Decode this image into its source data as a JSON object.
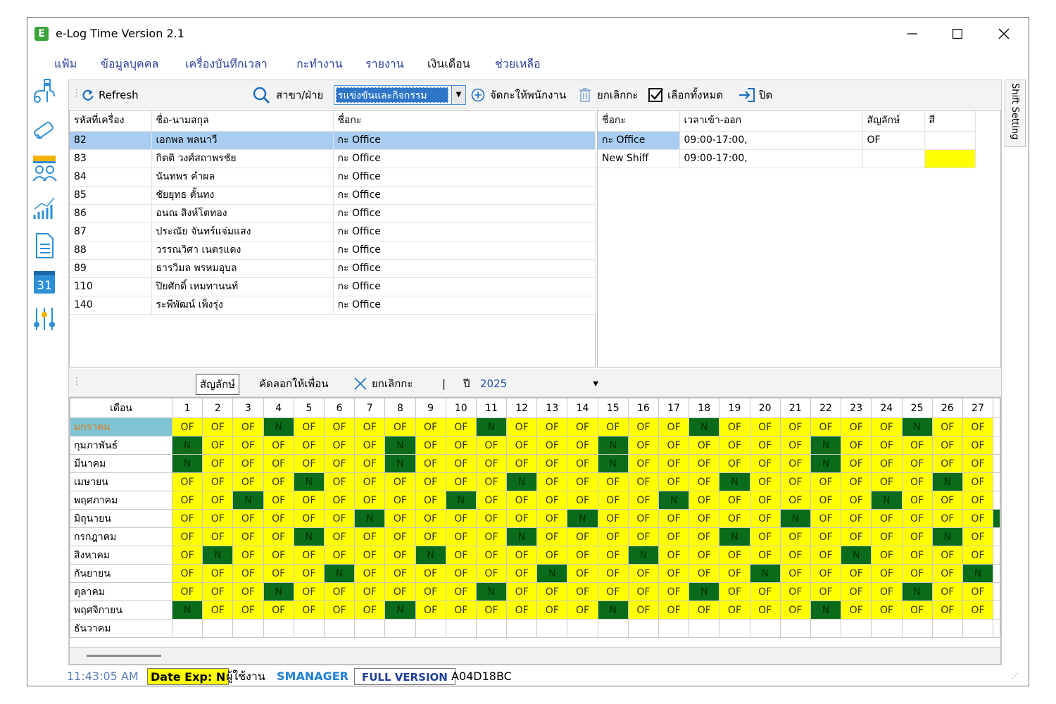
{
  "window": {
    "title": "e-Log Time Version 2.1",
    "app_icon_letter": "E"
  },
  "menu": [
    "แฟ้ม",
    "ข้อมูลบุคคล",
    "เครื่องบันทึกเวลา",
    "กะทำงาน",
    "รายงาน",
    "เงินเดือน",
    "ช่วยเหลือ"
  ],
  "sidebar_icons": [
    "usb-icon",
    "satellite-icon",
    "people-icon",
    "chart-icon",
    "document-icon",
    "calendar-icon",
    "sliders-icon"
  ],
  "calendar_icon_label": "31",
  "toolbar": {
    "refresh": "Refresh",
    "branch_label": "สาขา/ฝ่าย",
    "branch_value": "รแข่งขันและกิจกรรม",
    "assign": "จัดกะให้พนักงาน",
    "cancel_shift": "ยกเลิกกะ",
    "select_all": "เลือกทั้งหมด",
    "close": "ปิด"
  },
  "employees": {
    "headers": [
      "รหัสที่เครื่อง",
      "ชื่อ-นามสกุล",
      "ชื่อกะ"
    ],
    "rows": [
      [
        "82",
        "เอกพล  พลนาวี",
        "กะ Office"
      ],
      [
        "83",
        "กิตติ  วงศ์สถาพรชัย",
        "กะ Office"
      ],
      [
        "84",
        "นันทพร  คำผล",
        "กะ Office"
      ],
      [
        "85",
        "ชัยยุทธ  ตั้นทง",
        "กะ Office"
      ],
      [
        "86",
        "อนณ  สิงห์โตทอง",
        "กะ Office"
      ],
      [
        "87",
        "ประณัย  จันทร์แจ่มแสง",
        "กะ Office"
      ],
      [
        "88",
        "วรรณวิศา  เนตรแดง",
        "กะ Office"
      ],
      [
        "89",
        "ธารวิมล  พรหมอุบล",
        "กะ Office"
      ],
      [
        "110",
        "ปิยศักดิ์  เหมทานนท์",
        "กะ Office"
      ],
      [
        "140",
        "ระพีพัฒน์  เพ็งรุ่ง",
        "กะ Office"
      ]
    ]
  },
  "shifts": {
    "headers": [
      "ชื่อกะ",
      "เวลาเข้า-ออก",
      "สัญลักษ์",
      "สี"
    ],
    "rows": [
      {
        "name": "กะ Office",
        "time": "09:00-17:00,",
        "symbol": "OF",
        "color": ""
      },
      {
        "name": "New Shiff",
        "time": "09:00-17:00,",
        "symbol": "",
        "color": "#ffff00"
      }
    ]
  },
  "toolbar2": {
    "symbol": "สัญลักษ์",
    "copy": "คัดลอกให้เพื่อน",
    "cancel_shift": "ยกเลิกกะ",
    "separator": "|",
    "year_label": "ปี",
    "year_value": "2025"
  },
  "calendar": {
    "month_header": "เดือน",
    "days": [
      "1",
      "2",
      "3",
      "4",
      "5",
      "6",
      "7",
      "8",
      "9",
      "10",
      "11",
      "12",
      "13",
      "14",
      "15",
      "16",
      "17",
      "18",
      "19",
      "20",
      "21",
      "22",
      "23",
      "24",
      "25",
      "26",
      "27"
    ],
    "months": [
      "มกราคม",
      "กุมภาพันธ์",
      "มีนาคม",
      "เมษายน",
      "พฤศภาคม",
      "มิถุนายน",
      "กรกฎาคม",
      "สิงหาคม",
      "กันยายน",
      "ตุลาคม",
      "พฤศจิกายน",
      "ธันวาคม"
    ],
    "of_symbol": "OF",
    "n_symbol": "N",
    "n_days": [
      [
        4,
        11,
        18,
        25
      ],
      [
        1,
        8,
        15,
        22
      ],
      [
        1,
        8,
        15,
        22
      ],
      [
        5,
        12,
        19,
        26
      ],
      [
        3,
        10,
        17,
        24
      ],
      [
        7,
        14,
        21,
        28
      ],
      [
        5,
        12,
        19,
        26
      ],
      [
        2,
        9,
        16,
        23
      ],
      [
        6,
        13,
        20,
        27
      ],
      [
        4,
        11,
        18,
        25
      ],
      [
        1,
        8,
        15,
        22
      ],
      []
    ],
    "highlight_month_index": 0,
    "filled_months": 11,
    "colors": {
      "of": "#ffff00",
      "n": "#0a6b1a",
      "highlight": "#7ec4d4"
    }
  },
  "side_tab": "Shift Setting",
  "status": {
    "time": "11:43:05 AM",
    "date_exp": "Date Exp: N",
    "user_label": "ผู้ใช้งาน",
    "user": "SMANAGER",
    "version": "FULL VERSION",
    "code": "A04D18BC"
  }
}
